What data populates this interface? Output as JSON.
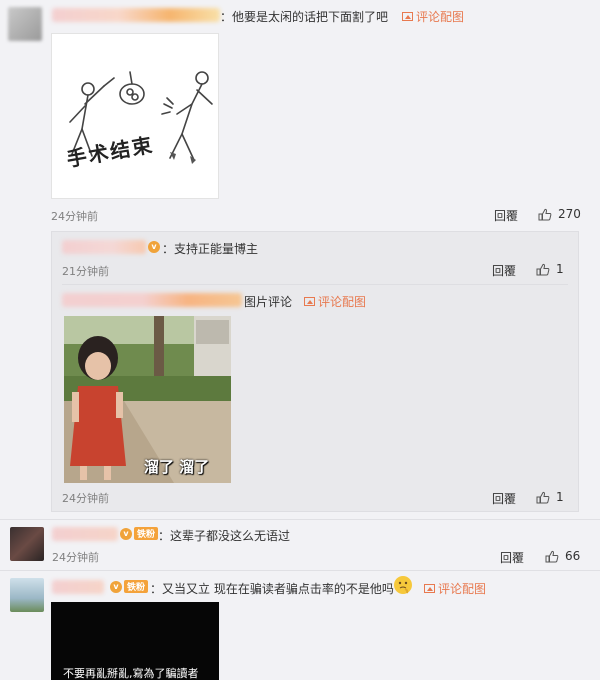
{
  "comments": [
    {
      "text": "：他要是太闲的话把下面割了吧",
      "pic_comment": "评论配图",
      "image_caption": "手术结束",
      "time": "24分钟前",
      "reply": "回覆",
      "likes": "270",
      "replies": [
        {
          "text": "：支持正能量博主",
          "time": "21分钟前",
          "reply": "回覆",
          "likes": "1"
        },
        {
          "text": "图片评论",
          "pic_comment": "评论配图",
          "image_caption": "溜了 溜了",
          "time": "24分钟前",
          "reply": "回覆",
          "likes": "1"
        }
      ]
    },
    {
      "text": "：这辈子都没这么无语过",
      "badge": "铁粉",
      "time": "24分钟前",
      "reply": "回覆",
      "likes": "66"
    },
    {
      "text": "：又当又立 现在在骗读者骗点击率的不是他吗",
      "badge": "铁粉",
      "pic_comment": "评论配图",
      "image_caption": "不要再亂掰亂,寫為了騙讀者"
    }
  ],
  "colors": {
    "accent": "#e8794f",
    "badge": "#f4a23a",
    "background": "#f2f2f5"
  }
}
